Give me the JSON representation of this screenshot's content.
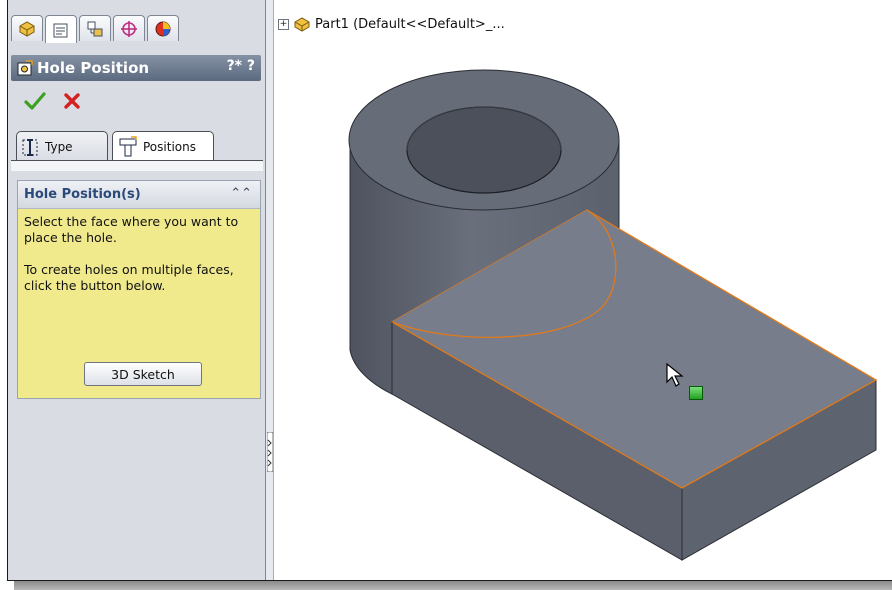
{
  "panel": {
    "manager_tabs": [
      {
        "icon": "feature-manager-icon"
      },
      {
        "icon": "property-manager-icon"
      },
      {
        "icon": "configuration-manager-icon"
      },
      {
        "icon": "dimxpert-manager-icon"
      },
      {
        "icon": "display-manager-icon"
      }
    ],
    "title": "Hole Position",
    "help_label": "?* ?",
    "tabs": [
      {
        "label": "Type",
        "icon": "hole-type-icon"
      },
      {
        "label": "Positions",
        "icon": "hole-positions-icon"
      }
    ],
    "group": {
      "title": "Hole Position(s)",
      "message_1": "Select the face where you want to place the hole.",
      "message_2": "To create holes on multiple faces, click the button below.",
      "button_label": "3D Sketch"
    }
  },
  "graphics": {
    "tree_root_label": "Part1  (Default<<Default>_..."
  },
  "colors": {
    "panel_title_bg": "#6b788c",
    "group_bg": "#f0ea8c",
    "group_title": "#2b4a7a",
    "model_top": "#757a88",
    "model_side": "#5d6270",
    "edge_highlight": "#e07a1a",
    "handle": "#28b028"
  }
}
